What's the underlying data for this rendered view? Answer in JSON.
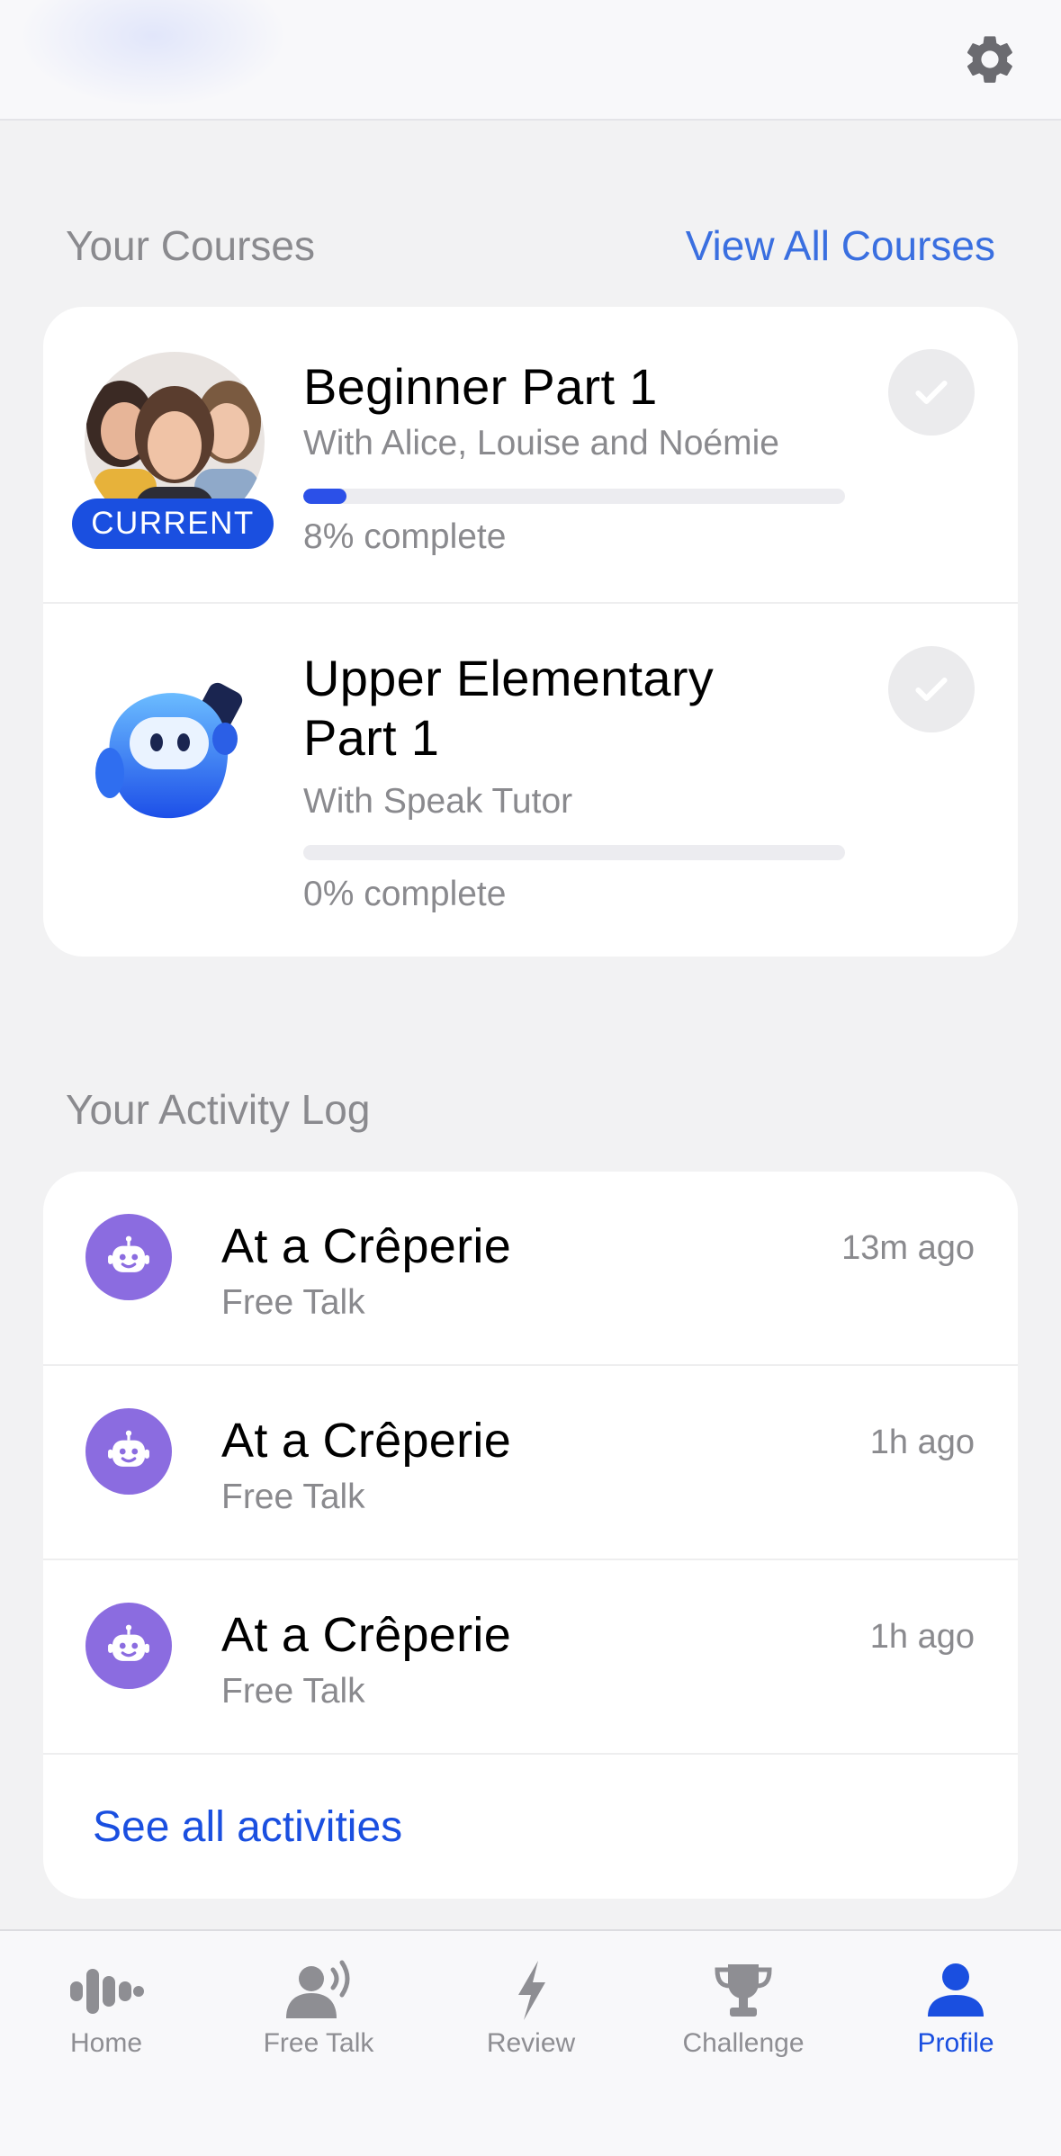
{
  "header": {
    "settings_icon": "gear-icon"
  },
  "courses_section": {
    "title": "Your Courses",
    "view_all_label": "View All Courses",
    "courses": [
      {
        "title": "Beginner Part 1",
        "subtitle": "With Alice, Louise and Noémie",
        "progress": 8,
        "progress_label": "8% complete",
        "badge": "CURRENT",
        "image": "tutors-photo",
        "check_icon": "check-icon"
      },
      {
        "title": "Upper Elementary Part 1",
        "subtitle": "With Speak Tutor",
        "progress": 0,
        "progress_label": "0% complete",
        "image": "speak-tutor-mascot",
        "check_icon": "check-icon"
      }
    ]
  },
  "activity_section": {
    "title": "Your Activity Log",
    "items": [
      {
        "title": "At a Crêperie",
        "subtitle": "Free Talk",
        "time": "13m ago",
        "icon": "robot-icon"
      },
      {
        "title": "At a Crêperie",
        "subtitle": "Free Talk",
        "time": "1h ago",
        "icon": "robot-icon"
      },
      {
        "title": "At a Crêperie",
        "subtitle": "Free Talk",
        "time": "1h ago",
        "icon": "robot-icon"
      }
    ],
    "see_all_label": "See all activities"
  },
  "tabbar": {
    "tabs": [
      {
        "label": "Home",
        "icon": "waveform-icon",
        "active": false
      },
      {
        "label": "Free Talk",
        "icon": "speaking-person-icon",
        "active": false
      },
      {
        "label": "Review",
        "icon": "lightning-icon",
        "active": false
      },
      {
        "label": "Challenge",
        "icon": "trophy-icon",
        "active": false
      },
      {
        "label": "Profile",
        "icon": "person-icon",
        "active": true
      }
    ]
  },
  "colors": {
    "accent": "#1a4fe0",
    "link": "#3a6fe0",
    "activity_icon_bg": "#8b6ce0",
    "background": "#f2f2f3"
  }
}
